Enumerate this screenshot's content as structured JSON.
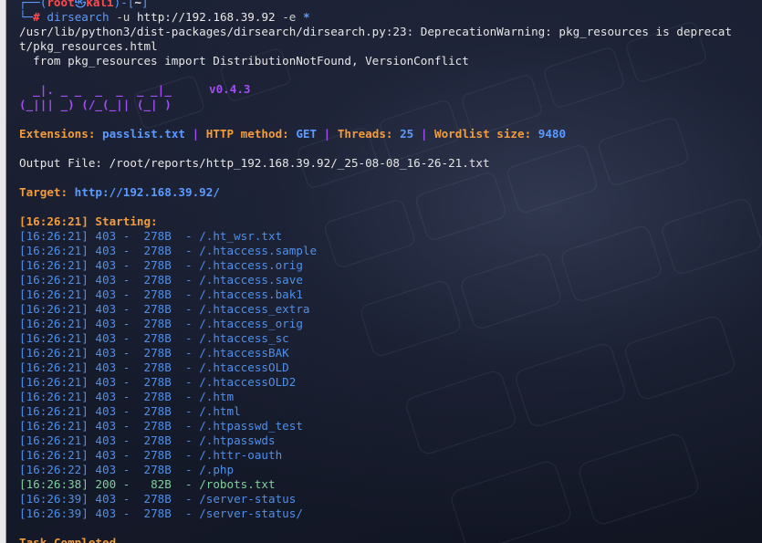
{
  "prompt": {
    "top": "┌──(",
    "user": "root",
    "at": "㉿",
    "host": "kali",
    "mid": ")-[",
    "dir": "~",
    "end": "]",
    "bottom": "└─",
    "hash": "#",
    "command": "dirsearch",
    "arg1": "-u",
    "url": "http://192.168.39.92",
    "arg2": "-e",
    "arg3": "*"
  },
  "warning": {
    "line1": "/usr/lib/python3/dist-packages/dirsearch/dirsearch.py:23: DeprecationWarning: pkg_resources is deprecat",
    "line2": "t/pkg_resources.html",
    "line3": "  from pkg_resources import DistributionNotFound, VersionConflict"
  },
  "banner": {
    "logo_line1": "  _|. _ _  _  _  _ _|_",
    "logo_line2": "(_||| _) (/_(_|| (_| )",
    "version": "v0.4.3"
  },
  "config": {
    "ext_label": "Extensions: ",
    "ext_value": "passlist.txt",
    "sep": " | ",
    "method_label": "HTTP method: ",
    "method_value": "GET",
    "threads_label": "Threads: ",
    "threads_value": "25",
    "wordlist_label": "Wordlist size: ",
    "wordlist_value": "9480"
  },
  "output_file": "Output File: /root/reports/http_192.168.39.92/_25-08-08_16-26-21.txt",
  "target": {
    "label": "Target: ",
    "value": "http://192.168.39.92/"
  },
  "starting": "[16:26:21] Starting: ",
  "results": [
    {
      "time": "[16:26:21]",
      "status": "403",
      "size": "278B",
      "path": "/.ht_wsr.txt"
    },
    {
      "time": "[16:26:21]",
      "status": "403",
      "size": "278B",
      "path": "/.htaccess.sample"
    },
    {
      "time": "[16:26:21]",
      "status": "403",
      "size": "278B",
      "path": "/.htaccess.orig"
    },
    {
      "time": "[16:26:21]",
      "status": "403",
      "size": "278B",
      "path": "/.htaccess.save"
    },
    {
      "time": "[16:26:21]",
      "status": "403",
      "size": "278B",
      "path": "/.htaccess.bak1"
    },
    {
      "time": "[16:26:21]",
      "status": "403",
      "size": "278B",
      "path": "/.htaccess_extra"
    },
    {
      "time": "[16:26:21]",
      "status": "403",
      "size": "278B",
      "path": "/.htaccess_orig"
    },
    {
      "time": "[16:26:21]",
      "status": "403",
      "size": "278B",
      "path": "/.htaccess_sc"
    },
    {
      "time": "[16:26:21]",
      "status": "403",
      "size": "278B",
      "path": "/.htaccessBAK"
    },
    {
      "time": "[16:26:21]",
      "status": "403",
      "size": "278B",
      "path": "/.htaccessOLD"
    },
    {
      "time": "[16:26:21]",
      "status": "403",
      "size": "278B",
      "path": "/.htaccessOLD2"
    },
    {
      "time": "[16:26:21]",
      "status": "403",
      "size": "278B",
      "path": "/.htm"
    },
    {
      "time": "[16:26:21]",
      "status": "403",
      "size": "278B",
      "path": "/.html"
    },
    {
      "time": "[16:26:21]",
      "status": "403",
      "size": "278B",
      "path": "/.htpasswd_test"
    },
    {
      "time": "[16:26:21]",
      "status": "403",
      "size": "278B",
      "path": "/.htpasswds"
    },
    {
      "time": "[16:26:21]",
      "status": "403",
      "size": "278B",
      "path": "/.httr-oauth"
    },
    {
      "time": "[16:26:22]",
      "status": "403",
      "size": "278B",
      "path": "/.php"
    },
    {
      "time": "[16:26:38]",
      "status": "200",
      "size": "82B",
      "path": "/robots.txt"
    },
    {
      "time": "[16:26:39]",
      "status": "403",
      "size": "278B",
      "path": "/server-status"
    },
    {
      "time": "[16:26:39]",
      "status": "403",
      "size": "278B",
      "path": "/server-status/"
    }
  ],
  "task_completed": "Task Completed",
  "colors": {
    "blue": "#5b9bff",
    "violet": "#a24df0",
    "orange": "#f39c3a",
    "path_blue": "#4f8fe8",
    "ok_green": "#7fd19b",
    "prompt_red": "#ff4b4b"
  }
}
